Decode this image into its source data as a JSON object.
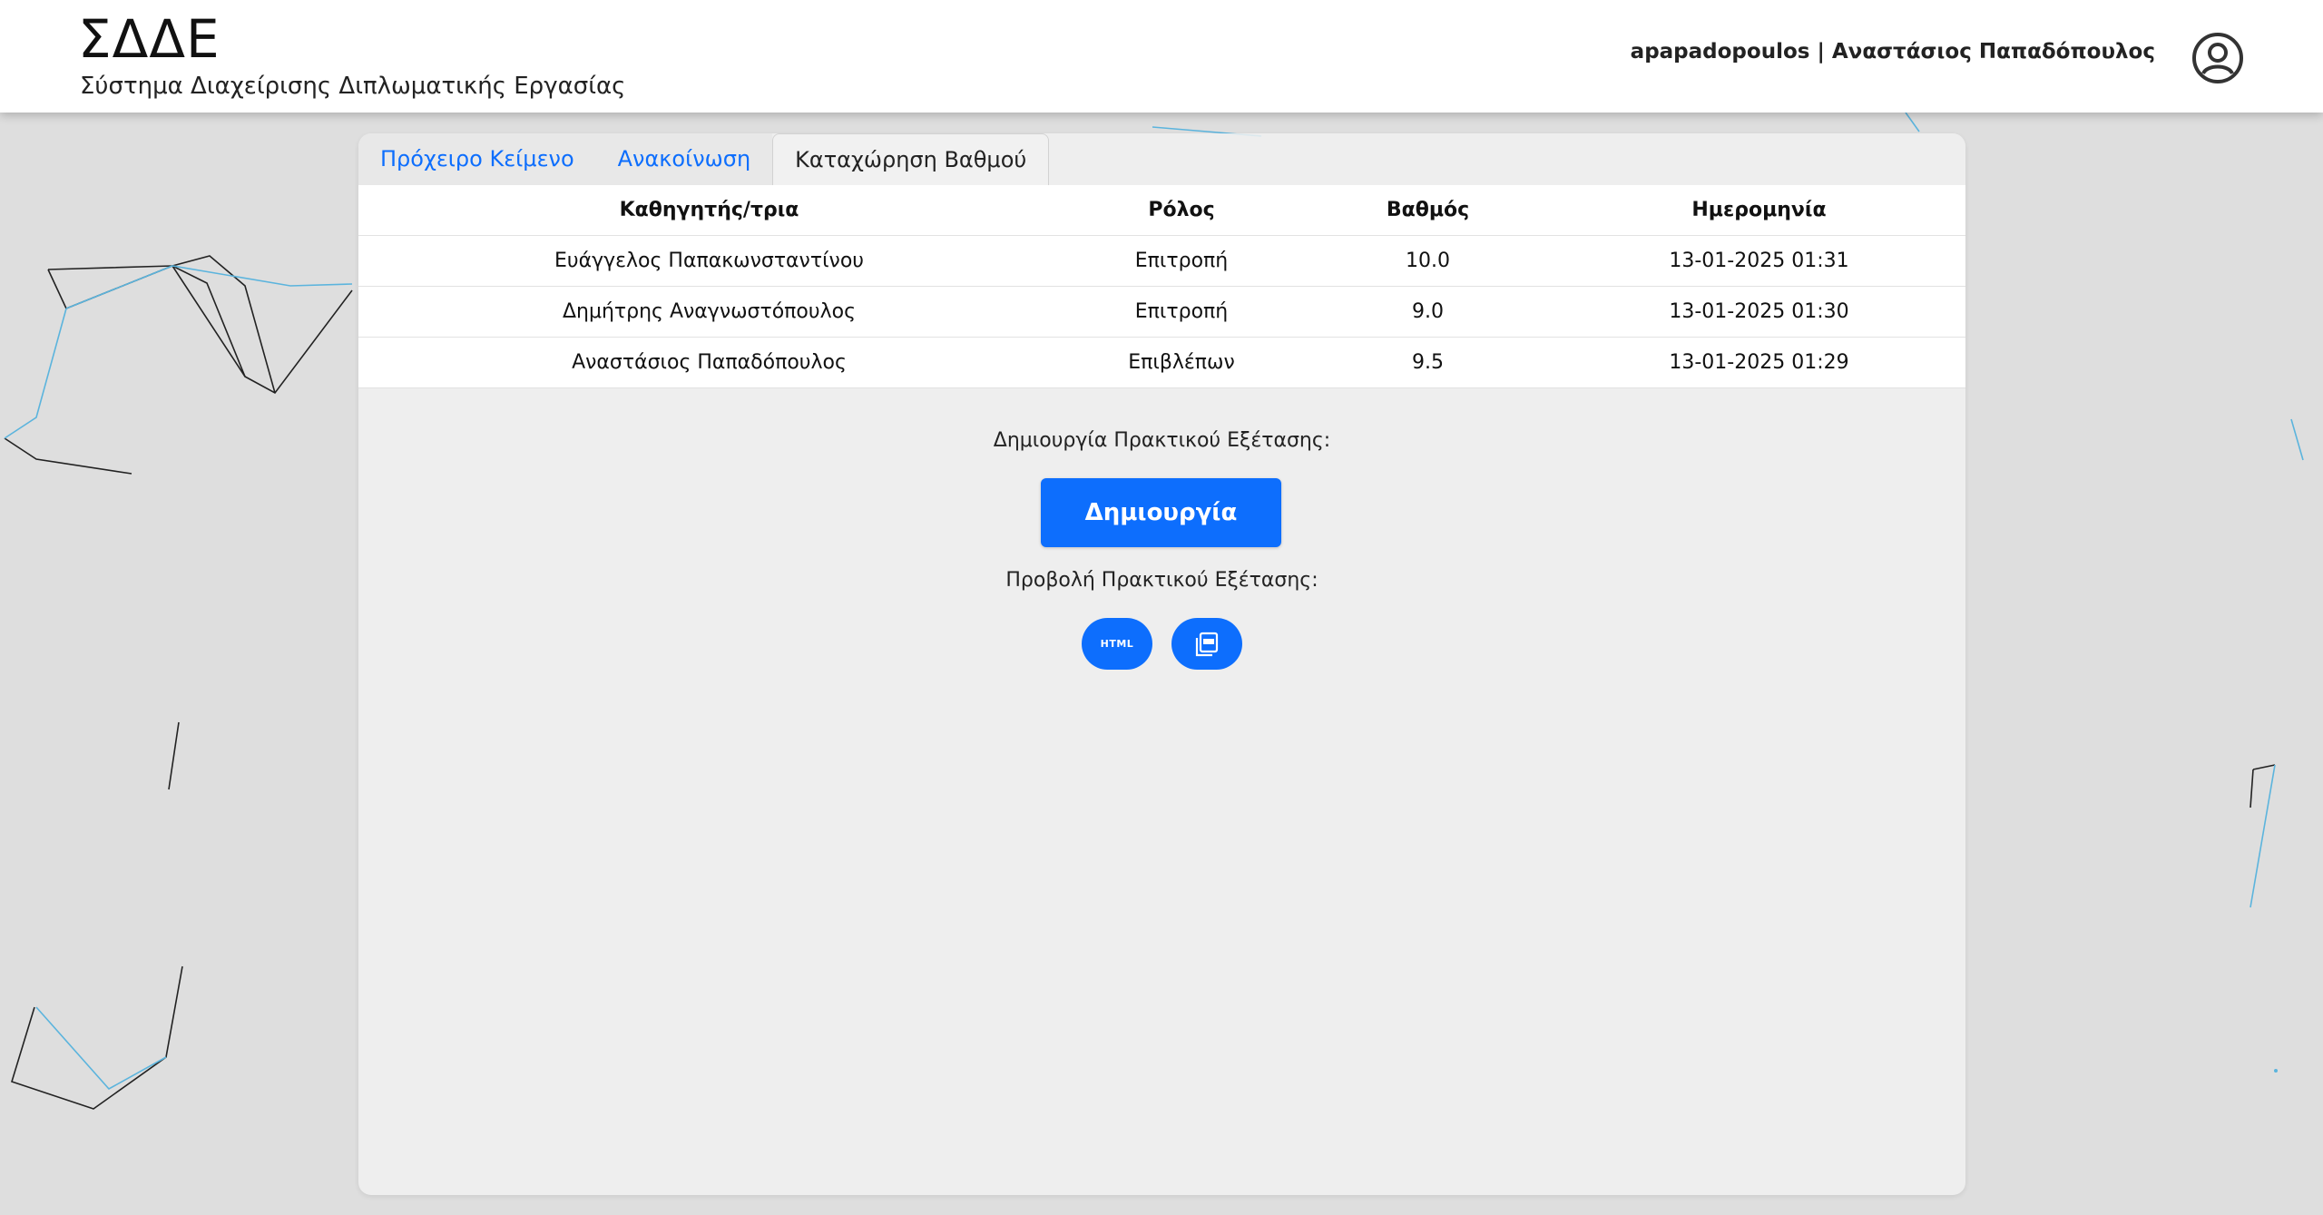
{
  "header": {
    "title": "ΣΔΔΕ",
    "subtitle": "Σύστημα Διαχείρισης Διπλωματικής Εργασίας",
    "user": "apapadopoulos | Αναστάσιος Παπαδόπουλος",
    "user_icon": "account-circle-icon"
  },
  "tabs": [
    {
      "label": "Πρόχειρο Κείμενο",
      "active": false
    },
    {
      "label": "Ανακοίνωση",
      "active": false
    },
    {
      "label": "Καταχώρηση Βαθμού",
      "active": true
    }
  ],
  "grades_table": {
    "headers": [
      "Καθηγητής/τρια",
      "Ρόλος",
      "Βαθμός",
      "Ημερομηνία"
    ],
    "rows": [
      [
        "Ευάγγελος Παπακωνσταντίνου",
        "Επιτροπή",
        "10.0",
        "13-01-2025 01:31"
      ],
      [
        "Δημήτρης Αναγνωστόπουλος",
        "Επιτροπή",
        "9.0",
        "13-01-2025 01:30"
      ],
      [
        "Αναστάσιος Παπαδόπουλος",
        "Επιβλέπων",
        "9.5",
        "13-01-2025 01:29"
      ]
    ]
  },
  "create_section": {
    "label": "Δημιουργία Πρακτικού Εξέτασης:",
    "button": "Δημιουργία"
  },
  "view_section": {
    "label": "Προβολή Πρακτικού Εξέτασης:",
    "html_button": "HTML",
    "pdf_button_icon": "pdf-icon"
  },
  "colors": {
    "primary": "#0d6efd",
    "background": "#dedede"
  }
}
